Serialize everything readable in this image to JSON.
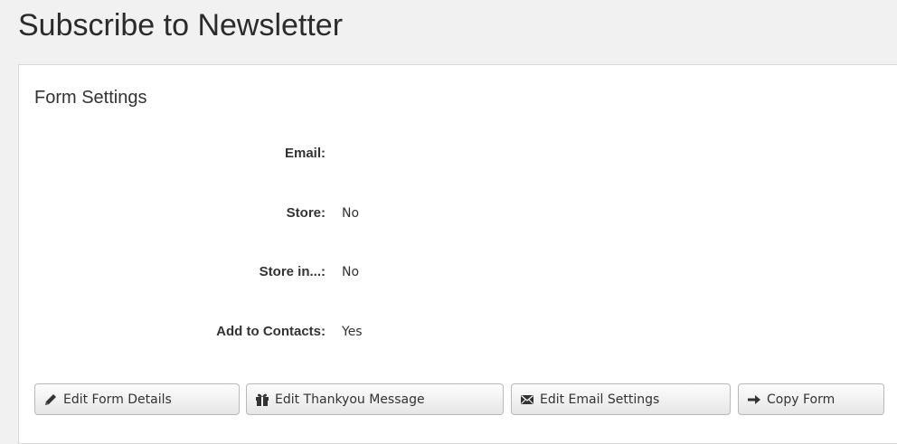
{
  "page": {
    "title": "Subscribe to Newsletter"
  },
  "panel": {
    "title": "Form Settings",
    "fields": [
      {
        "label": "Email:",
        "value": ""
      },
      {
        "label": "Store:",
        "value": "No"
      },
      {
        "label": "Store in...:",
        "value": "No"
      },
      {
        "label": "Add to Contacts:",
        "value": "Yes"
      }
    ]
  },
  "buttons": [
    {
      "label": "Edit Form Details",
      "icon": "pencil-icon"
    },
    {
      "label": "Edit Thankyou Message",
      "icon": "gift-icon"
    },
    {
      "label": "Edit Email Settings",
      "icon": "envelope-icon"
    },
    {
      "label": "Copy Form",
      "icon": "arrow-right-icon"
    }
  ],
  "colors": {
    "background": "#f1f1f1",
    "panel": "#ffffff",
    "text": "#333333"
  }
}
